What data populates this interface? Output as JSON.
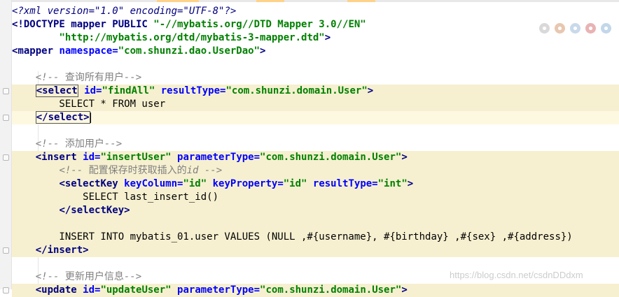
{
  "editor": {
    "lines": [
      {
        "hl": false,
        "segs": [
          [
            "pi",
            "<?xml version=\"1.0\" encoding=\"UTF-8\"?>"
          ]
        ]
      },
      {
        "hl": false,
        "segs": [
          [
            "tag",
            "<!DOCTYPE mapper PUBLIC "
          ],
          [
            "av",
            "\"-//mybatis.org//DTD Mapper 3.0//EN\""
          ]
        ]
      },
      {
        "hl": false,
        "segs": [
          [
            "t",
            "        "
          ],
          [
            "av",
            "\"http://mybatis.org/dtd/mybatis-3-mapper.dtd\""
          ],
          [
            "tag",
            ">"
          ]
        ]
      },
      {
        "hl": false,
        "segs": [
          [
            "tag",
            "<mapper "
          ],
          [
            "an",
            "namespace="
          ],
          [
            "av",
            "\"com.shunzi.dao.UserDao\""
          ],
          [
            "tag",
            ">"
          ]
        ]
      },
      {
        "hl": false,
        "segs": []
      },
      {
        "hl": false,
        "segs": [
          [
            "t",
            "    "
          ],
          [
            "cm",
            "<!-- "
          ],
          [
            "cmc",
            "查询所有用户"
          ],
          [
            "cm",
            "-->"
          ]
        ]
      },
      {
        "hl": true,
        "segs": [
          [
            "t",
            "    "
          ],
          [
            "tagb",
            "<select"
          ],
          [
            "tag",
            " "
          ],
          [
            "an",
            "id="
          ],
          [
            "av",
            "\"findAll\""
          ],
          [
            "an",
            " resultType="
          ],
          [
            "av",
            "\"com.shunzi.domain.User\""
          ],
          [
            "tag",
            ">"
          ]
        ]
      },
      {
        "hl": true,
        "segs": [
          [
            "t",
            "        SELECT * FROM user"
          ]
        ]
      },
      {
        "hl": true,
        "cur": true,
        "segs": [
          [
            "t",
            "    "
          ],
          [
            "tagb",
            "</select>"
          ],
          [
            "caret",
            ""
          ]
        ]
      },
      {
        "hl": false,
        "segs": []
      },
      {
        "hl": false,
        "segs": [
          [
            "t",
            "    "
          ],
          [
            "cm",
            "<!-- "
          ],
          [
            "cmc",
            "添加用户"
          ],
          [
            "cm",
            "-->"
          ]
        ]
      },
      {
        "hl": true,
        "segs": [
          [
            "t",
            "    "
          ],
          [
            "tag",
            "<insert "
          ],
          [
            "an",
            "id="
          ],
          [
            "av",
            "\"insertUser\""
          ],
          [
            "an",
            " parameterType="
          ],
          [
            "av",
            "\"com.shunzi.domain.User\""
          ],
          [
            "tag",
            ">"
          ]
        ]
      },
      {
        "hl": true,
        "segs": [
          [
            "t",
            "        "
          ],
          [
            "cm",
            "<!-- "
          ],
          [
            "cmc",
            "配置保存时获取插入的"
          ],
          [
            "cm",
            "id -->"
          ]
        ]
      },
      {
        "hl": true,
        "segs": [
          [
            "t",
            "        "
          ],
          [
            "tag",
            "<selectKey "
          ],
          [
            "an",
            "keyColumn="
          ],
          [
            "av",
            "\"id\""
          ],
          [
            "an",
            " keyProperty="
          ],
          [
            "av",
            "\"id\""
          ],
          [
            "an",
            " resultType="
          ],
          [
            "av",
            "\"int\""
          ],
          [
            "tag",
            ">"
          ]
        ]
      },
      {
        "hl": true,
        "segs": [
          [
            "t",
            "            SELECT last_insert_id()"
          ]
        ]
      },
      {
        "hl": true,
        "segs": [
          [
            "t",
            "        "
          ],
          [
            "tag",
            "</selectKey>"
          ]
        ]
      },
      {
        "hl": true,
        "segs": []
      },
      {
        "hl": true,
        "segs": [
          [
            "t",
            "        INSERT INTO mybatis_01.user VALUES (NULL ,#{username}, #{birthday} ,#{sex} ,#{address})"
          ]
        ]
      },
      {
        "hl": true,
        "segs": [
          [
            "t",
            "    "
          ],
          [
            "tag",
            "</insert>"
          ]
        ]
      },
      {
        "hl": false,
        "segs": []
      },
      {
        "hl": false,
        "segs": [
          [
            "t",
            "    "
          ],
          [
            "cm",
            "<!-- "
          ],
          [
            "cmc",
            "更新用户信息"
          ],
          [
            "cm",
            "-->"
          ]
        ]
      },
      {
        "hl": true,
        "segs": [
          [
            "t",
            "    "
          ],
          [
            "tag",
            "<update "
          ],
          [
            "an",
            "id="
          ],
          [
            "av",
            "\"updateUser\""
          ],
          [
            "an",
            " parameterType="
          ],
          [
            "av",
            "\"com.shunzi.domain.User\""
          ],
          [
            "tag",
            ">"
          ]
        ]
      }
    ]
  },
  "browser_icons": [
    {
      "name": "chrome-icon",
      "color": "#d9d9d9"
    },
    {
      "name": "firefox-icon",
      "color": "#e8c7b0"
    },
    {
      "name": "ie-icon",
      "color": "#c9d9ec"
    },
    {
      "name": "opera-icon",
      "color": "#e9b3b3"
    },
    {
      "name": "edge-icon",
      "color": "#c3d7ea"
    }
  ],
  "watermark": "https://blog.csdn.net/csdnDDdxm",
  "colors": {
    "tag": "#000080",
    "attr_name": "#0000ff",
    "attr_value": "#008000",
    "comment": "#808080",
    "highlight": "#f6f0d0"
  }
}
